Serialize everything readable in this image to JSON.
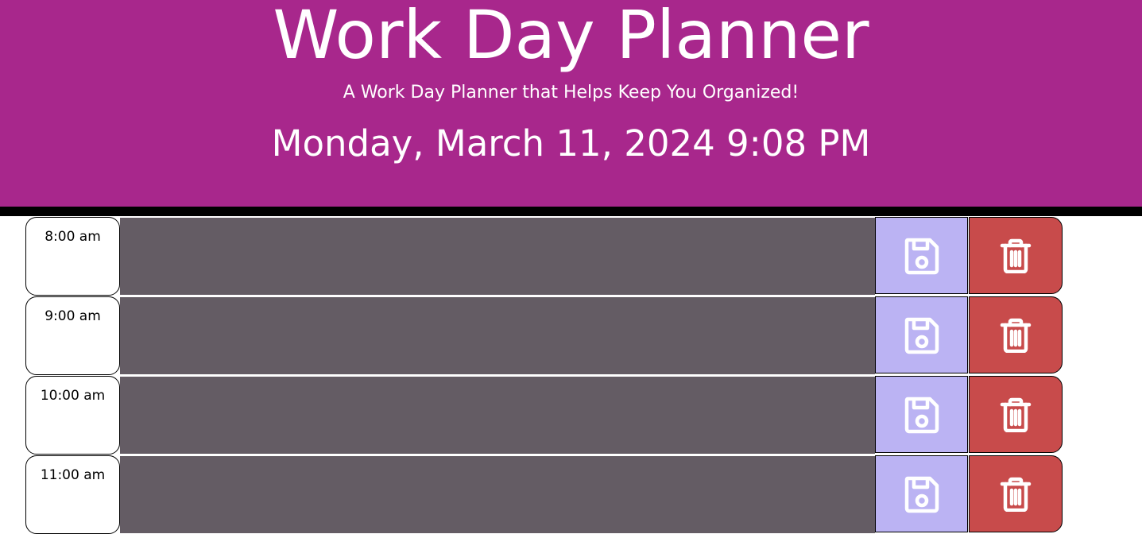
{
  "header": {
    "title": "Work Day Planner",
    "subtitle": "A Work Day Planner that Helps Keep You Organized!",
    "current_date": "Monday, March 11, 2024 9:08 PM"
  },
  "colors": {
    "header_bg": "#a8278c",
    "past_block": "#645c64",
    "save_button": "#bbb3f3",
    "delete_button": "#c84b4b"
  },
  "timeblocks": [
    {
      "hour": "8:00 am",
      "description": "",
      "save_icon": "floppy-disk-icon",
      "delete_icon": "trash-icon"
    },
    {
      "hour": "9:00 am",
      "description": "",
      "save_icon": "floppy-disk-icon",
      "delete_icon": "trash-icon"
    },
    {
      "hour": "10:00 am",
      "description": "",
      "save_icon": "floppy-disk-icon",
      "delete_icon": "trash-icon"
    },
    {
      "hour": "11:00 am",
      "description": "",
      "save_icon": "floppy-disk-icon",
      "delete_icon": "trash-icon"
    }
  ]
}
